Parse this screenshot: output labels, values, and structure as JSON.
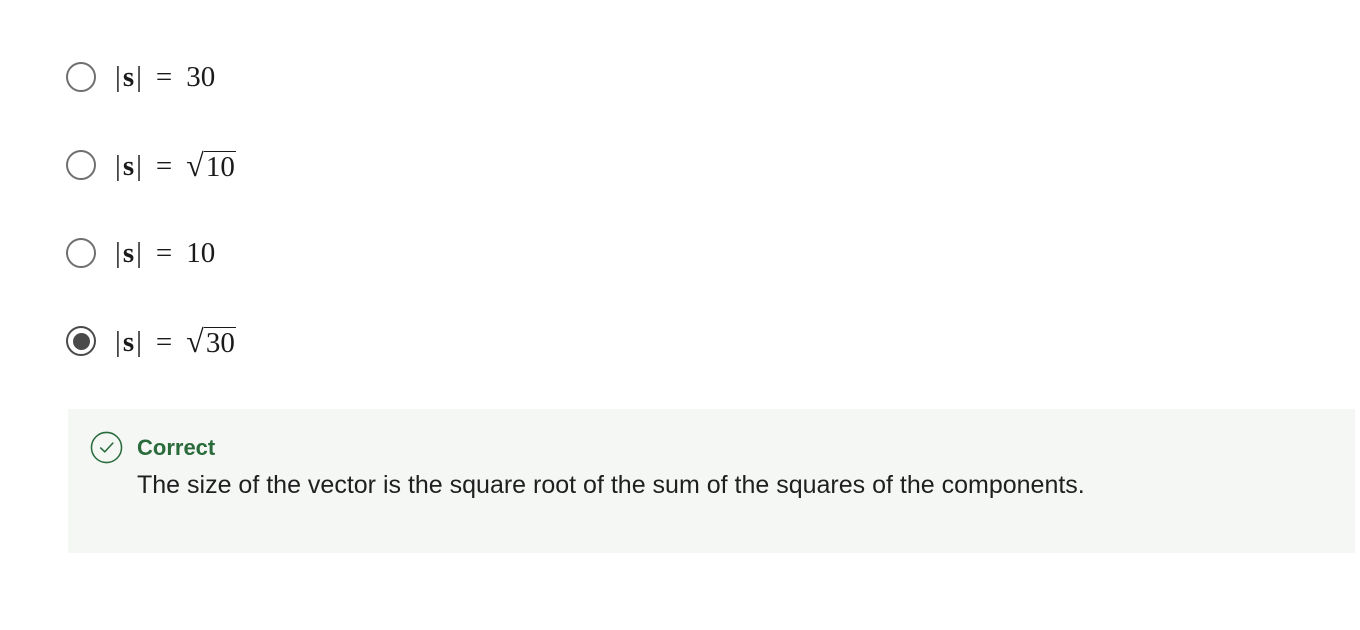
{
  "options": [
    {
      "lhs": "|s|",
      "eq": "=",
      "value": "30",
      "sqrt": false,
      "selected": false
    },
    {
      "lhs": "|s|",
      "eq": "=",
      "value": "10",
      "sqrt": true,
      "selected": false
    },
    {
      "lhs": "|s|",
      "eq": "=",
      "value": "10",
      "sqrt": false,
      "selected": false
    },
    {
      "lhs": "|s|",
      "eq": "=",
      "value": "30",
      "sqrt": true,
      "selected": true
    }
  ],
  "feedback": {
    "status": "Correct",
    "icon": "check-circle-icon",
    "explanation": "The size of the vector is the square root of the sum of the squares of the components.",
    "accent_color": "#2a6b3c",
    "background_color": "#f5f7f5"
  },
  "symbols": {
    "abs_bar": "|",
    "vector_letter": "s",
    "radical": "√"
  }
}
